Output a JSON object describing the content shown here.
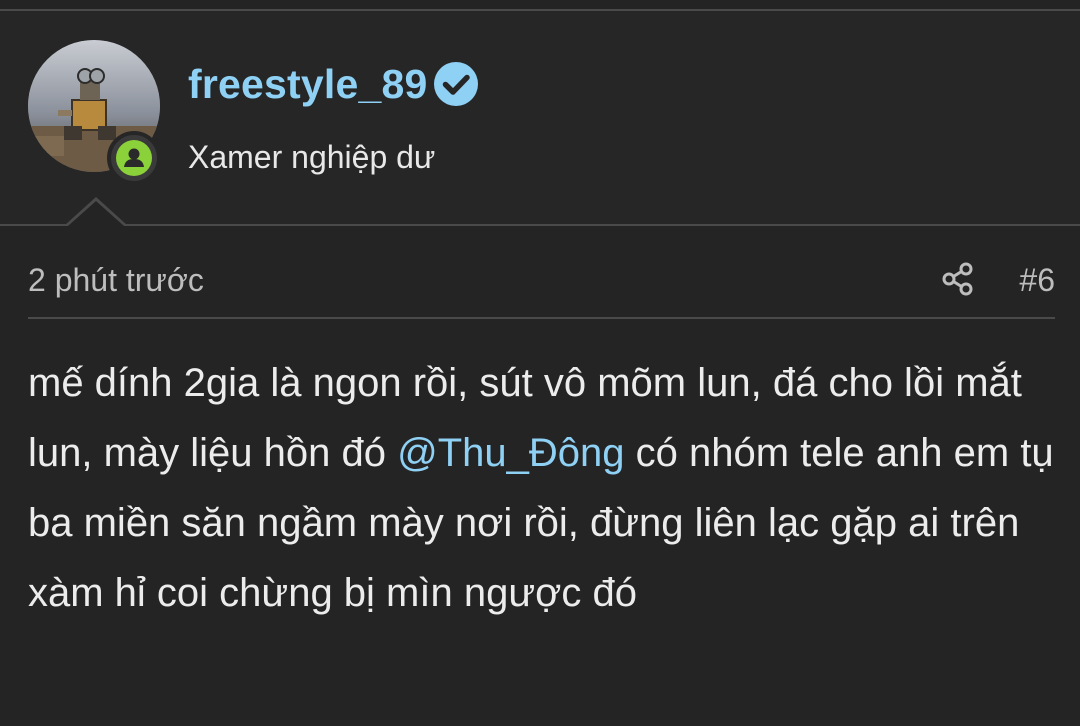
{
  "user": {
    "username": "freestyle_89",
    "title": "Xamer nghiệp dư",
    "verified": true,
    "online": true
  },
  "post": {
    "timestamp": "2 phút trước",
    "number": "#6",
    "body_before": "mế dính 2gia là ngon rồi, sút vô mõm lun, đá cho lồi mắt lun, mày liệu hồn đó ",
    "mention": "@Thu_Đông",
    "body_after": " có nhóm tele anh em tụ ba miền săn ngầm mày nơi rồi, đừng liên lạc gặp ai trên xàm hỉ coi chừng bị mìn ngược đó"
  },
  "icons": {
    "verified": "verified-check-icon",
    "online": "online-user-icon",
    "share": "share-icon"
  },
  "colors": {
    "background": "#242424",
    "accent": "#8fd0f5",
    "online": "#8bd13a",
    "text": "#ececec",
    "muted": "#bdbdbd"
  }
}
